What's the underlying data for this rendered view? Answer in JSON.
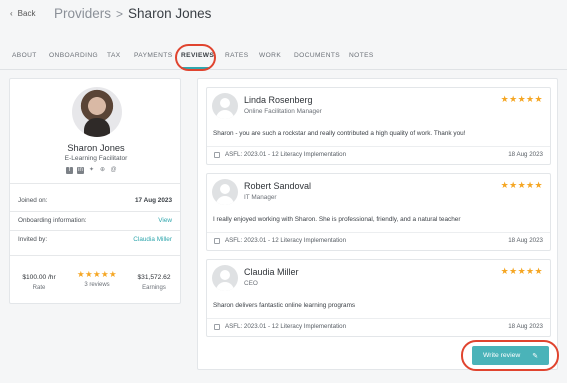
{
  "header": {
    "back_label": "Back",
    "breadcrumb_parent": "Providers",
    "breadcrumb_separator": ">",
    "breadcrumb_current": "Sharon Jones"
  },
  "tabs": [
    {
      "label": "ABOUT",
      "active": false
    },
    {
      "label": "ONBOARDING",
      "active": false
    },
    {
      "label": "TAX",
      "active": false
    },
    {
      "label": "PAYMENTS",
      "active": false
    },
    {
      "label": "REVIEWS",
      "active": true
    },
    {
      "label": "RATES",
      "active": false
    },
    {
      "label": "WORK",
      "active": false
    },
    {
      "label": "DOCUMENTS",
      "active": false
    },
    {
      "label": "NOTES",
      "active": false
    }
  ],
  "profile": {
    "name": "Sharon Jones",
    "role": "E-Learning Facilitator",
    "socials": [
      "facebook-icon",
      "linkedin-icon",
      "twitter-icon",
      "globe-icon",
      "email-icon"
    ],
    "joined_label": "Joined on:",
    "joined_value": "17 Aug 2023",
    "onboarding_label": "Onboarding information:",
    "onboarding_value": "View",
    "invited_label": "Invited by:",
    "invited_value": "Claudia Miller",
    "rate_value": "$100.00 /hr",
    "rate_label": "Rate",
    "reviews_stars": "★★★★★",
    "reviews_count": "3 reviews",
    "earnings_value": "$31,572.62",
    "earnings_label": "Earnings"
  },
  "reviews": [
    {
      "name": "Linda Rosenberg",
      "title": "Online Facilitation Manager",
      "stars": "★★★★★",
      "rating": 5,
      "text": "Sharon - you are such a rockstar and really contributed a high quality of work. Thank you!",
      "course": "ASFL: 2023.01 - 12 Literacy Implementation",
      "date": "18 Aug 2023"
    },
    {
      "name": "Robert Sandoval",
      "title": "IT Manager",
      "stars": "★★★★★",
      "rating": 5,
      "text": "I really enjoyed working with Sharon. She is professional, friendly, and a natural teacher",
      "course": "ASFL: 2023.01 - 12 Literacy Implementation",
      "date": "18 Aug 2023"
    },
    {
      "name": "Claudia Miller",
      "title": "CEO",
      "stars": "★★★★★",
      "rating": 5,
      "text": "Sharon delivers fantastic online learning programs",
      "course": "ASFL: 2023.01 - 12 Literacy Implementation",
      "date": "18 Aug 2023"
    }
  ],
  "actions": {
    "write_review_label": "Write review"
  },
  "colors": {
    "accent": "#2fa6ad",
    "button": "#4ab3b9",
    "star": "#f5a623",
    "highlight": "#e0442f"
  }
}
